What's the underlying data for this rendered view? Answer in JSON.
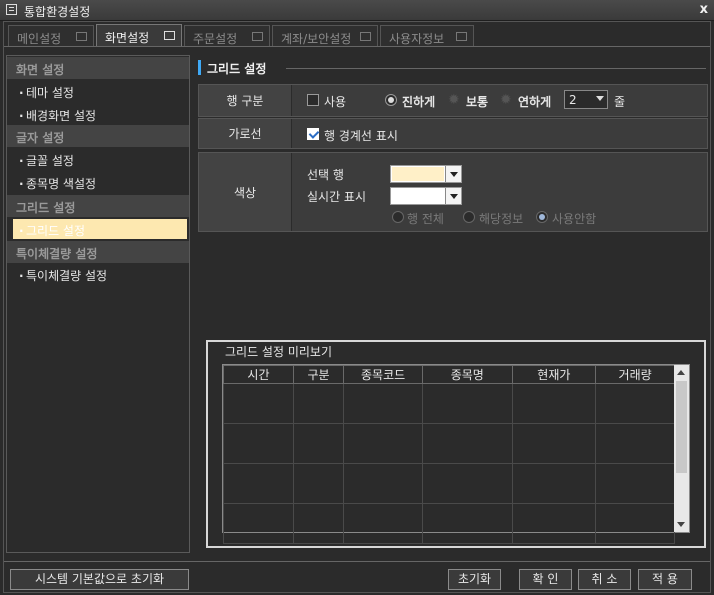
{
  "window": {
    "title": "통합환경설정",
    "close": "x"
  },
  "tabs": [
    {
      "label": "메인설정",
      "icon": "screen-icon"
    },
    {
      "label": "화면설정",
      "icon": "windows-icon"
    },
    {
      "label": "주문설정",
      "icon": "calculator-icon"
    },
    {
      "label": "계좌/보안설정",
      "icon": "lock-icon"
    },
    {
      "label": "사용자정보",
      "icon": "user-icon"
    }
  ],
  "sidebar": {
    "sections": [
      {
        "title": "화면 설정",
        "items": [
          "테마 설정",
          "배경화면 설정"
        ]
      },
      {
        "title": "글자 설정",
        "items": [
          "글꼴 설정",
          "종목명 색설정"
        ]
      },
      {
        "title": "그리드 설정",
        "items": [
          "그리드 설정"
        ]
      },
      {
        "title": "특이체결량 설정",
        "items": [
          "특이체결량 설정"
        ]
      }
    ],
    "bullet": "·",
    "selected": "그리드 설정"
  },
  "main": {
    "title": "그리드 설정",
    "row_divider": {
      "label": "행 구분",
      "use_label": "사용",
      "use_checked": false,
      "options": [
        "진하게",
        "보통",
        "연하게"
      ],
      "selected_option": "진하게",
      "count_value": "2",
      "count_unit": "줄"
    },
    "gridline": {
      "label": "가로선",
      "checkbox_label": "행 경계선 표시",
      "checked": true
    },
    "color": {
      "label": "색상",
      "selected_row_label": "선택 행",
      "realtime_label": "실시간 표시",
      "selected_row_color": "#fff0c8",
      "realtime_color": "#ffffff",
      "scope_options": [
        "행 전체",
        "해당정보",
        "사용안함"
      ],
      "scope_selected": "사용안함"
    }
  },
  "preview": {
    "title": "그리드 설정 미리보기",
    "columns": [
      "시간",
      "구분",
      "종목코드",
      "종목명",
      "현재가",
      "거래량"
    ]
  },
  "buttons": {
    "reset_default": "시스템 기본값으로 초기화",
    "reset": "초기화",
    "ok": "확 인",
    "cancel": "취 소",
    "apply": "적 용"
  },
  "colors": {
    "accent": "#3fa9f5",
    "selected_item_bg": "#fde8b0",
    "background": "#2b2b2b"
  }
}
